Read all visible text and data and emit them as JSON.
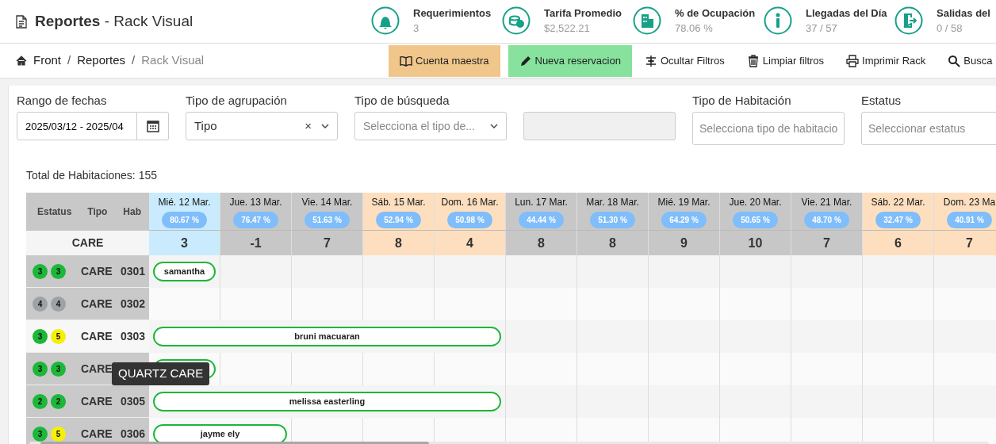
{
  "title": "**Reportes** - Rack Visual",
  "kpis": [
    {
      "label": "Requerimientos",
      "value": "3"
    },
    {
      "label": "Tarifa Promedio",
      "value": "$2,522.21"
    },
    {
      "label": "% de Ocupación",
      "value": "78.06 %"
    },
    {
      "label": "Llegadas del Día",
      "value": "37 / 57"
    },
    {
      "label": "Salidas del",
      "value": "0 / 58"
    }
  ],
  "breadcrumb": [
    {
      "label": "Front",
      "current": false
    },
    {
      "separator": "/",
      "label": "Reportes",
      "current": false
    },
    {
      "separator": "/",
      "label": "Rack Visual",
      "current": true
    }
  ],
  "actions": [
    {
      "label": "Cuenta maestra",
      "kind": "warning"
    },
    {
      "label": "Nueva reservacion",
      "kind": "success"
    },
    {
      "label": "Ocultar Filtros",
      "kind": "plain"
    },
    {
      "label": "Limpiar filtros",
      "kind": "plain"
    },
    {
      "label": "Imprimir Rack",
      "kind": "plain"
    },
    {
      "label": "Busca",
      "kind": "plain"
    }
  ],
  "filters": [
    {
      "kind": "date",
      "label": "Rango de fechas",
      "value": "2025/03/12 - 2025/04"
    },
    {
      "kind": "select",
      "label": "Tipo de agrupación",
      "value": "Tipo",
      "clear": "×"
    },
    {
      "kind": "select",
      "label": "Tipo de búsqueda",
      "placeholder": "Selecciona el tipo de..."
    },
    {
      "kind": "disabled"
    },
    {
      "kind": "multi",
      "label": "Tipo de Habitación",
      "placeholder": "Selecciona tipo de habitacio"
    },
    {
      "kind": "multi",
      "label": "Estatus",
      "placeholder": "Seleccionar estatus"
    }
  ],
  "total": "Total de Habitaciones: 155",
  "grid": {
    "columns": [
      "Estatus",
      "Tipo",
      "Hab"
    ],
    "group": "CARE",
    "days": [
      {
        "label": "Mié. 12 Mar.",
        "occupancy": "80.67 %",
        "available": "3",
        "kind": "today"
      },
      {
        "label": "Jue. 13 Mar.",
        "occupancy": "76.47 %",
        "available": "-1",
        "kind": "weekday"
      },
      {
        "label": "Vie. 14 Mar.",
        "occupancy": "51.63 %",
        "available": "7",
        "kind": "weekday"
      },
      {
        "label": "Sáb. 15 Mar.",
        "occupancy": "52.94 %",
        "available": "8",
        "kind": "weekend"
      },
      {
        "label": "Dom. 16 Mar.",
        "occupancy": "50.98 %",
        "available": "4",
        "kind": "weekend"
      },
      {
        "label": "Lun. 17 Mar.",
        "occupancy": "44.44 %",
        "available": "8",
        "kind": "weekday"
      },
      {
        "label": "Mar. 18 Mar.",
        "occupancy": "51.30 %",
        "available": "8",
        "kind": "weekday"
      },
      {
        "label": "Mié. 19 Mar.",
        "occupancy": "64.29 %",
        "available": "9",
        "kind": "weekday"
      },
      {
        "label": "Jue. 20 Mar.",
        "occupancy": "50.65 %",
        "available": "10",
        "kind": "weekday"
      },
      {
        "label": "Vie. 21 Mar.",
        "occupancy": "48.70 %",
        "available": "7",
        "kind": "weekday"
      },
      {
        "label": "Sáb. 22 Mar.",
        "occupancy": "32.47 %",
        "available": "6",
        "kind": "weekend"
      },
      {
        "label": "Dom. 23 Ma",
        "occupancy": "40.91 %",
        "available": "7",
        "kind": "weekend"
      }
    ],
    "rooms": [
      {
        "status": [
          {
            "text": "3",
            "color": "#1db73a"
          },
          {
            "text": "3",
            "color": "#1db73a"
          }
        ],
        "type": "CARE",
        "number": "0301",
        "highlighted": false,
        "guest": "samantha",
        "occupied": [
          true,
          false,
          false,
          false,
          false,
          false,
          false,
          false,
          false,
          false,
          false,
          false
        ]
      },
      {
        "status": [
          {
            "text": "4",
            "color": "#9ca3a5"
          },
          {
            "text": "4",
            "color": "#9ca3a5"
          }
        ],
        "type": "CARE",
        "number": "0302",
        "highlighted": false,
        "occupied": [
          false,
          false,
          false,
          false,
          false,
          false,
          false,
          false,
          false,
          false,
          false,
          false
        ]
      },
      {
        "status": [
          {
            "text": "3",
            "color": "#1db73a"
          },
          {
            "text": "5",
            "color": "#f5ef0a"
          }
        ],
        "type": "CARE",
        "number": "0303",
        "highlighted": true,
        "guest": "bruni macuaran",
        "occupied": [
          true,
          true,
          true,
          true,
          true,
          false,
          false,
          false,
          false,
          false,
          false,
          false
        ]
      },
      {
        "status": [
          {
            "text": "3",
            "color": "#1db73a"
          },
          {
            "text": "3",
            "color": "#1db73a"
          }
        ],
        "type": "CARE",
        "highlighted": false,
        "occupied": [
          true,
          false,
          false,
          false,
          false,
          false,
          false,
          false,
          false,
          false,
          false,
          false
        ]
      },
      {
        "status": [
          {
            "text": "2",
            "color": "#1db73a"
          },
          {
            "text": "2",
            "color": "#1db73a"
          }
        ],
        "type": "CARE",
        "number": "0305",
        "highlighted": false,
        "guest": "melissa easterling",
        "occupied": [
          true,
          true,
          true,
          true,
          true,
          false,
          false,
          false,
          false,
          false,
          false,
          false
        ]
      },
      {
        "status": [
          {
            "text": "3",
            "color": "#1db73a"
          },
          {
            "text": "5",
            "color": "#f5ef0a"
          }
        ],
        "type": "CARE",
        "number": "0306",
        "highlighted": false,
        "guest": "jayme ely",
        "occupied": [
          true,
          true,
          false,
          false,
          false,
          false,
          false,
          false,
          false,
          false,
          false,
          false
        ]
      }
    ],
    "tooltip": "QUARTZ CARE"
  }
}
